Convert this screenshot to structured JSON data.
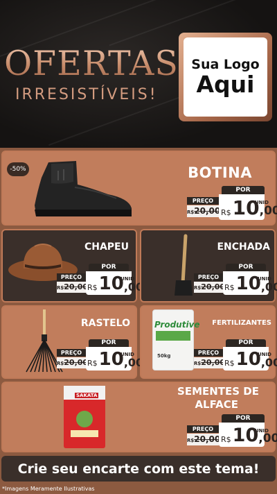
{
  "header": {
    "title": "OFERTAS",
    "subtitle": "IRRESISTÍVEIS!",
    "logo_line1": "Sua Logo",
    "logo_line2": "Aqui"
  },
  "badge": "-50%",
  "price_labels": {
    "preco": "PREÇO",
    "por": "POR",
    "unid": "UNID",
    "currency": "R$"
  },
  "products": [
    {
      "name": "BOTINA",
      "old_price": "20,00",
      "new_int": "10",
      "new_dec": ",00"
    },
    {
      "name": "CHAPEU",
      "old_price": "20,00",
      "new_int": "10",
      "new_dec": ",00"
    },
    {
      "name": "ENCHADA",
      "old_price": "20,00",
      "new_int": "10",
      "new_dec": ",00"
    },
    {
      "name": "RASTELO",
      "old_price": "20,00",
      "new_int": "10",
      "new_dec": ",00"
    },
    {
      "name": "FERTILIZANTES",
      "old_price": "20,00",
      "new_int": "10",
      "new_dec": ",00"
    },
    {
      "name_line1": "SEMENTES DE",
      "name_line2": "ALFACE",
      "old_price": "20,00",
      "new_int": "10",
      "new_dec": ",00"
    }
  ],
  "bag_labels": {
    "fertilizer_brand": "Produtive",
    "fertilizer_weight": "50kg",
    "seed_brand": "SAKATA"
  },
  "cta": "Crie seu encarte com este tema!",
  "footer": "*Imagens Meramente Ilustrativas",
  "colors": {
    "copper": "#c17d5c",
    "dark_card": "#3a2f2a",
    "background": "#8c5a40"
  }
}
